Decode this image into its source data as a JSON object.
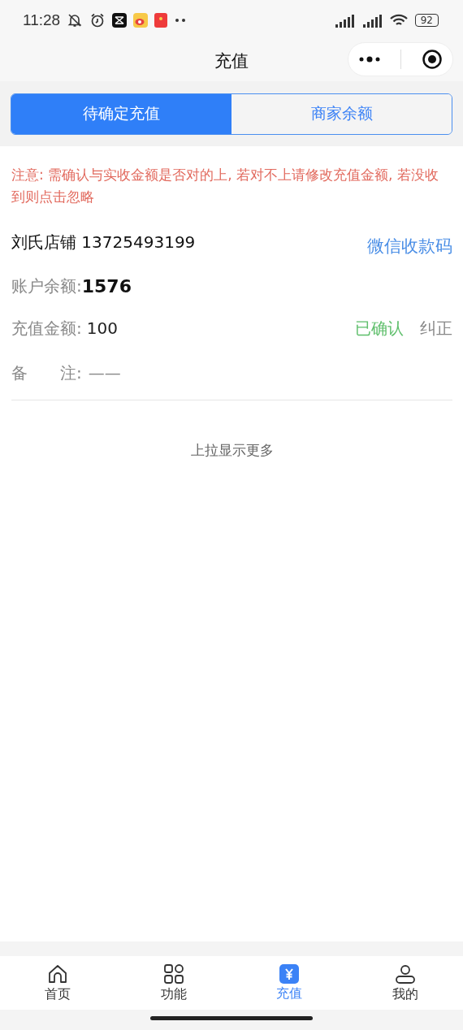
{
  "status_bar": {
    "time": "11:28",
    "battery": "92"
  },
  "header": {
    "title": "充值"
  },
  "tabs": [
    {
      "label": "待确定充值",
      "selected": true
    },
    {
      "label": "商家余额",
      "selected": false
    }
  ],
  "notice": "注意: 需确认与实收金额是否对的上, 若对不上请修改充值金额, 若没收到则点击忽略",
  "record": {
    "shop_name": "刘氏店铺",
    "phone": "13725493199",
    "qr_link": "微信收款码",
    "balance_label": "账户余额:",
    "balance": "1576",
    "amount_label": "充值金额:",
    "amount": "100",
    "status": "已确认",
    "correct": "纠正",
    "remark_label": "备　　注:",
    "remark": "——"
  },
  "load_more": "上拉显示更多",
  "tab_bar": [
    {
      "kind": "home",
      "label": "首页",
      "selected": false
    },
    {
      "kind": "grid",
      "label": "功能",
      "selected": false
    },
    {
      "kind": "yuan",
      "label": "充值",
      "selected": true
    },
    {
      "kind": "user",
      "label": "我的",
      "selected": false
    }
  ]
}
